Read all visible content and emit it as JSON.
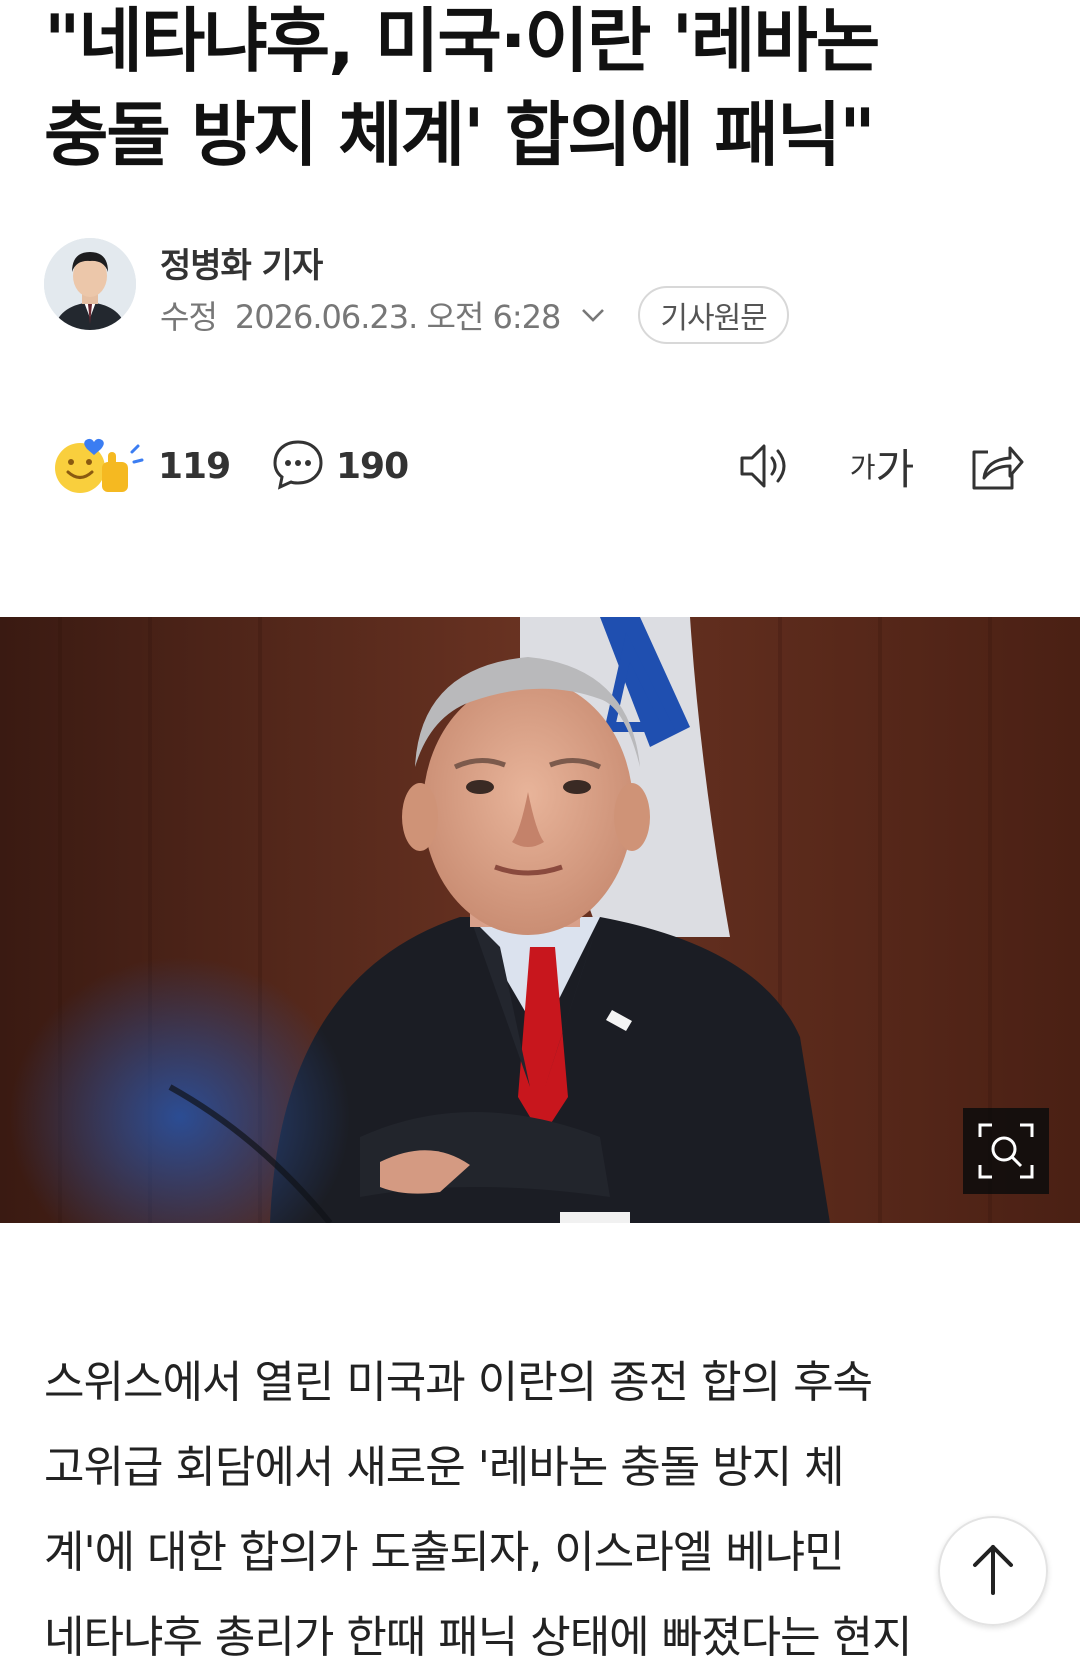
{
  "article": {
    "headline_line1": "\"네타냐후, 미국·이란 '레바논",
    "headline_line2": "충돌 방지 체계' 합의에 패닉\""
  },
  "byline": {
    "reporter": "정병화 기자",
    "modified_label": "수정",
    "datetime": "2026.06.23. 오전 6:28",
    "original_button": "기사원문"
  },
  "toolbar": {
    "reaction_count": "119",
    "comment_count": "190",
    "font_small": "가",
    "font_big": "가"
  },
  "body": {
    "line1": "스위스에서 열린 미국과 이란의 종전 합의 후속",
    "line2": "고위급 회담에서 새로운 '레바논 충돌 방지 체",
    "line3": "계'에 대한 합의가 도출되자, 이스라엘 베냐민",
    "line4": "네타냐후 총리가 한때 패닉 상태에 빠졌다는 현지"
  },
  "icons": {
    "reaction": "reaction-emoji-icon",
    "comment": "comment-bubble-icon",
    "speaker": "speaker-icon",
    "font": "font-size-icon",
    "share": "share-icon",
    "zoom": "zoom-search-icon",
    "top": "arrow-up-icon",
    "chevron": "chevron-down-icon"
  },
  "colors": {
    "text": "#111111",
    "meta": "#777777",
    "photo_bg": "#4a2418",
    "tie": "#c8161d",
    "flag_blue": "#1f4fb0"
  }
}
